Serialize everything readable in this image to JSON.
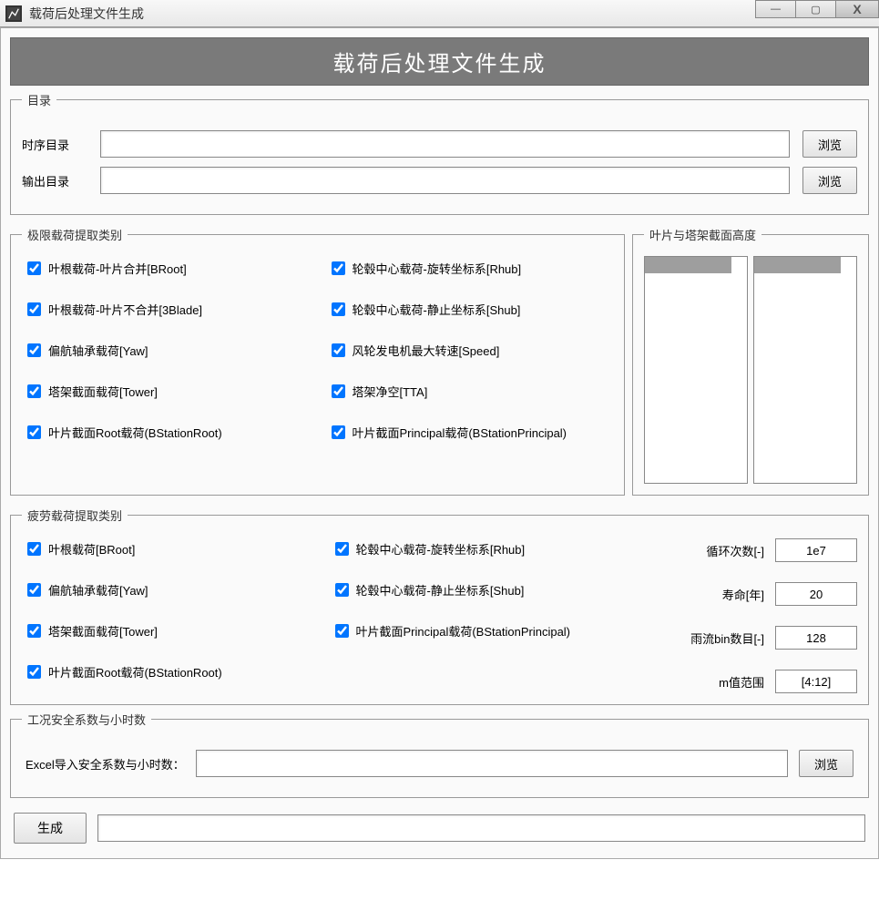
{
  "window": {
    "title": "载荷后处理文件生成"
  },
  "banner": "载荷后处理文件生成",
  "dir_group": {
    "legend": "目录",
    "ts_label": "时序目录",
    "ts_value": "",
    "out_label": "输出目录",
    "out_value": "",
    "browse_label": "浏览"
  },
  "extreme_group": {
    "legend": "极限载荷提取类别",
    "left": [
      "叶根载荷-叶片合并[BRoot]",
      "叶根载荷-叶片不合并[3Blade]",
      "偏航轴承载荷[Yaw]",
      "塔架截面载荷[Tower]",
      "叶片截面Root载荷(BStationRoot)"
    ],
    "right": [
      "轮毂中心载荷-旋转坐标系[Rhub]",
      "轮毂中心载荷-静止坐标系[Shub]",
      "风轮发电机最大转速[Speed]",
      "塔架净空[TTA]",
      "叶片截面Principal载荷(BStationPrincipal)"
    ]
  },
  "heights_group": {
    "legend": "叶片与塔架截面高度"
  },
  "fatigue_group": {
    "legend": "疲劳载荷提取类别",
    "left": [
      "叶根载荷[BRoot]",
      "偏航轴承载荷[Yaw]",
      "塔架截面载荷[Tower]",
      "叶片截面Root载荷(BStationRoot)"
    ],
    "right": [
      "轮毂中心载荷-旋转坐标系[Rhub]",
      "轮毂中心载荷-静止坐标系[Shub]",
      "叶片截面Principal载荷(BStationPrincipal)"
    ],
    "params": {
      "cycles_label": "循环次数[-]",
      "cycles_value": "1e7",
      "life_label": "寿命[年]",
      "life_value": "20",
      "bins_label": "雨流bin数目[-]",
      "bins_value": "128",
      "m_label": "m值范围",
      "m_value": "[4:12]"
    }
  },
  "safety_group": {
    "legend": "工况安全系数与小时数",
    "label": "Excel导入安全系数与小时数：",
    "value": "",
    "browse_label": "浏览"
  },
  "bottom": {
    "generate_label": "生成",
    "status_value": ""
  }
}
